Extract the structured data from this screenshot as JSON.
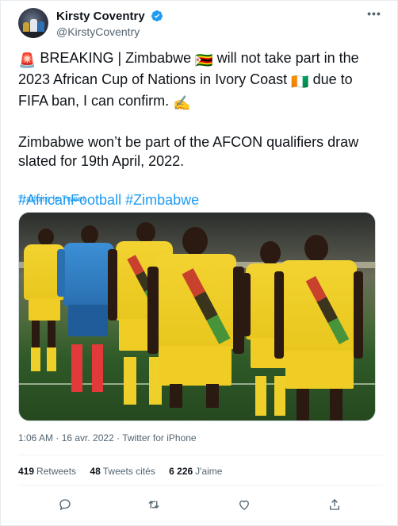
{
  "author": {
    "name": "Kirsty Coventry",
    "handle": "@KirstyCoventry",
    "verified": true
  },
  "menu": {
    "icon": "more-dots-icon",
    "label": "•••"
  },
  "tweet": {
    "emoji_siren": "🚨",
    "line1_part1": " BREAKING | Zimbabwe ",
    "emoji_flag_zw": "🇿🇼",
    "line1_part2": " will not take part in the 2023 African Cup of Nations in Ivory Coast ",
    "emoji_flag_ci": "🇨🇮",
    "line1_part3": " due to FIFA ban, I can confirm. ",
    "emoji_writing": "✍️",
    "paragraph2": "Zimbabwe won’t be part of the AFCON qualifiers draw slated for 19th April, 2022.",
    "hashtag1": "#AfricanFootball",
    "hashtag2": "#Zimbabwe",
    "translate": "Traduire le Tweet"
  },
  "meta": {
    "time": "1:06 AM",
    "separator": " · ",
    "date": "16 avr. 2022",
    "source": "Twitter for iPhone"
  },
  "stats": {
    "retweets_count": "419",
    "retweets_label": "Retweets",
    "quotes_count": "48",
    "quotes_label": "Tweets cités",
    "likes_count": "6 226",
    "likes_label": "J'aime"
  },
  "actions": [
    {
      "name": "reply-icon"
    },
    {
      "name": "retweet-icon"
    },
    {
      "name": "like-icon"
    },
    {
      "name": "share-icon"
    }
  ],
  "colors": {
    "accent": "#1d9bf0",
    "text": "#0f1419",
    "muted": "#536471",
    "jersey": "#f3d331"
  }
}
